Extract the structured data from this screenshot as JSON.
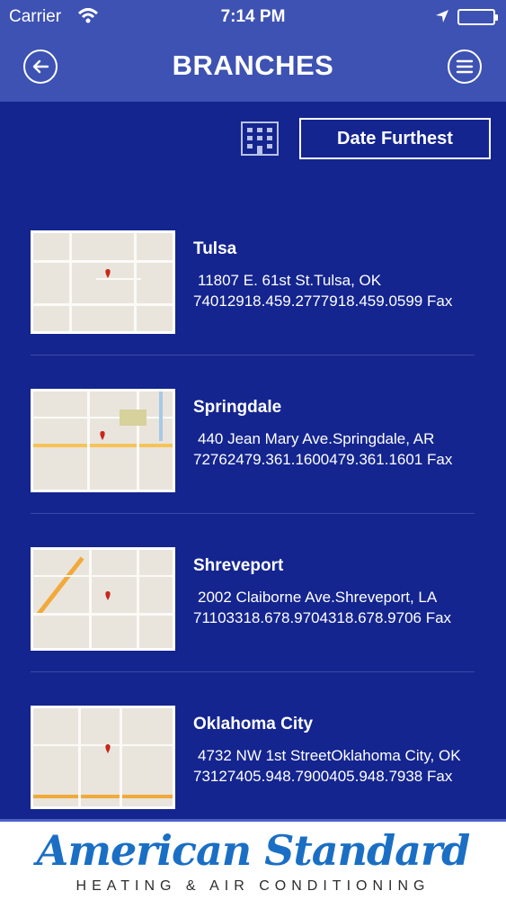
{
  "status_bar": {
    "carrier": "Carrier",
    "time": "7:14 PM"
  },
  "header": {
    "title": "BRANCHES"
  },
  "toolbar": {
    "sort_label": "Date Furthest"
  },
  "branches": [
    {
      "name": "Tulsa",
      "address": "11807 E. 61st St.Tulsa, OK",
      "contact": "74012918.459.2777918.459.0599 Fax"
    },
    {
      "name": "Springdale",
      "address": "440 Jean Mary Ave.Springdale, AR",
      "contact": "72762479.361.1600479.361.1601 Fax"
    },
    {
      "name": "Shreveport",
      "address": "2002 Claiborne Ave.Shreveport, LA",
      "contact": "71103318.678.9704318.678.9706 Fax"
    },
    {
      "name": "Oklahoma City",
      "address": "4732 NW 1st StreetOklahoma City, OK",
      "contact": "73127405.948.7900405.948.7938 Fax"
    }
  ],
  "footer": {
    "logo_name": "American Standard",
    "logo_sub": "HEATING & AIR CONDITIONING"
  },
  "colors": {
    "background": "#14258f",
    "header": "#3d52b2",
    "logo_blue": "#1a6fc4"
  }
}
